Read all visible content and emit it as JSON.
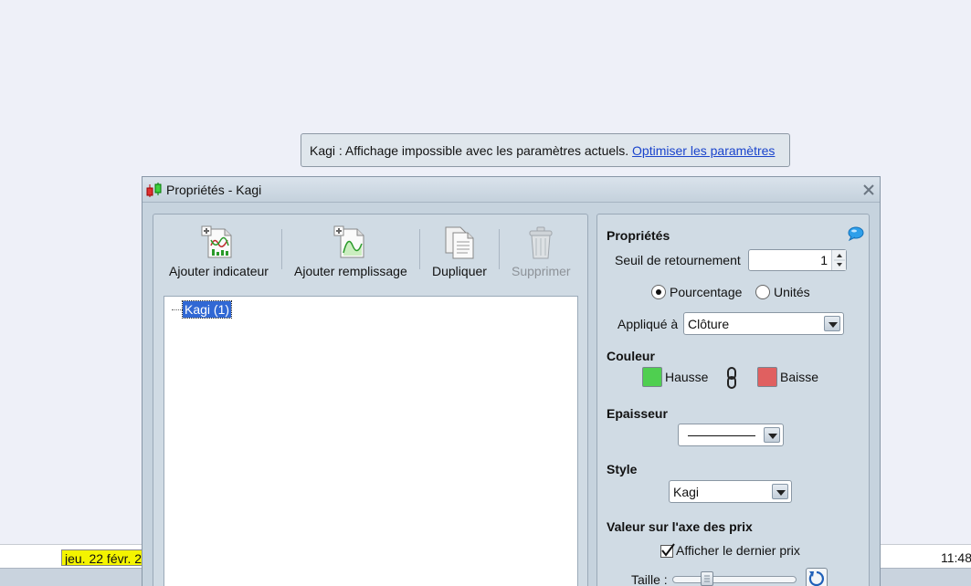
{
  "background": {
    "date_label": "jeu. 22 févr. 2",
    "time_label": "11:48"
  },
  "banner": {
    "message": "Kagi : Affichage impossible avec les paramètres actuels.",
    "link": "Optimiser les paramètres"
  },
  "dialog": {
    "title": "Propriétés - Kagi",
    "toolbar": {
      "add_indicator": "Ajouter indicateur",
      "add_fill": "Ajouter remplissage",
      "duplicate": "Dupliquer",
      "delete": "Supprimer"
    },
    "tree": {
      "items": [
        "Kagi (1)"
      ]
    },
    "properties": {
      "header": "Propriétés",
      "reversal_label": "Seuil de retournement",
      "reversal_value": "1",
      "radio_percent": "Pourcentage",
      "radio_units": "Unités",
      "selected_mode": "Pourcentage",
      "applied_label": "Appliqué à",
      "applied_value": "Clôture",
      "color_header": "Couleur",
      "up_label": "Hausse",
      "down_label": "Baisse",
      "up_color": "#4fcf50",
      "down_color": "#e06060",
      "thickness_header": "Epaisseur",
      "style_header": "Style",
      "style_value": "Kagi",
      "price_axis_header": "Valeur sur l'axe des prix",
      "show_last_price_label": "Afficher le dernier prix",
      "show_last_price_checked": true,
      "size_label": "Taille :"
    }
  }
}
